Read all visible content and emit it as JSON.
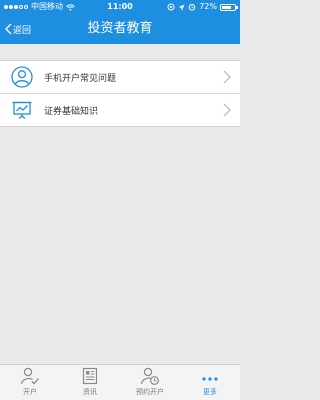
{
  "status_bar": {
    "carrier": "中国移动",
    "time": "11:00",
    "battery": "72%",
    "battery_level": 0.72
  },
  "header": {
    "back_label": "返回",
    "title": "投资者教育"
  },
  "menu": {
    "items": [
      {
        "label": "手机开户常见问题",
        "icon": "user-icon"
      },
      {
        "label": "证券基础知识",
        "icon": "chart-board-icon"
      }
    ]
  },
  "tabbar": {
    "tabs": [
      {
        "label": "开户",
        "icon": "user-check-icon"
      },
      {
        "label": "资讯",
        "icon": "document-icon"
      },
      {
        "label": "预约开户",
        "icon": "user-clock-icon"
      },
      {
        "label": "更多",
        "icon": "more-icon"
      }
    ],
    "active_index": 3
  },
  "colors": {
    "accent": "#1e8fe0",
    "background": "#e9e9e9"
  }
}
